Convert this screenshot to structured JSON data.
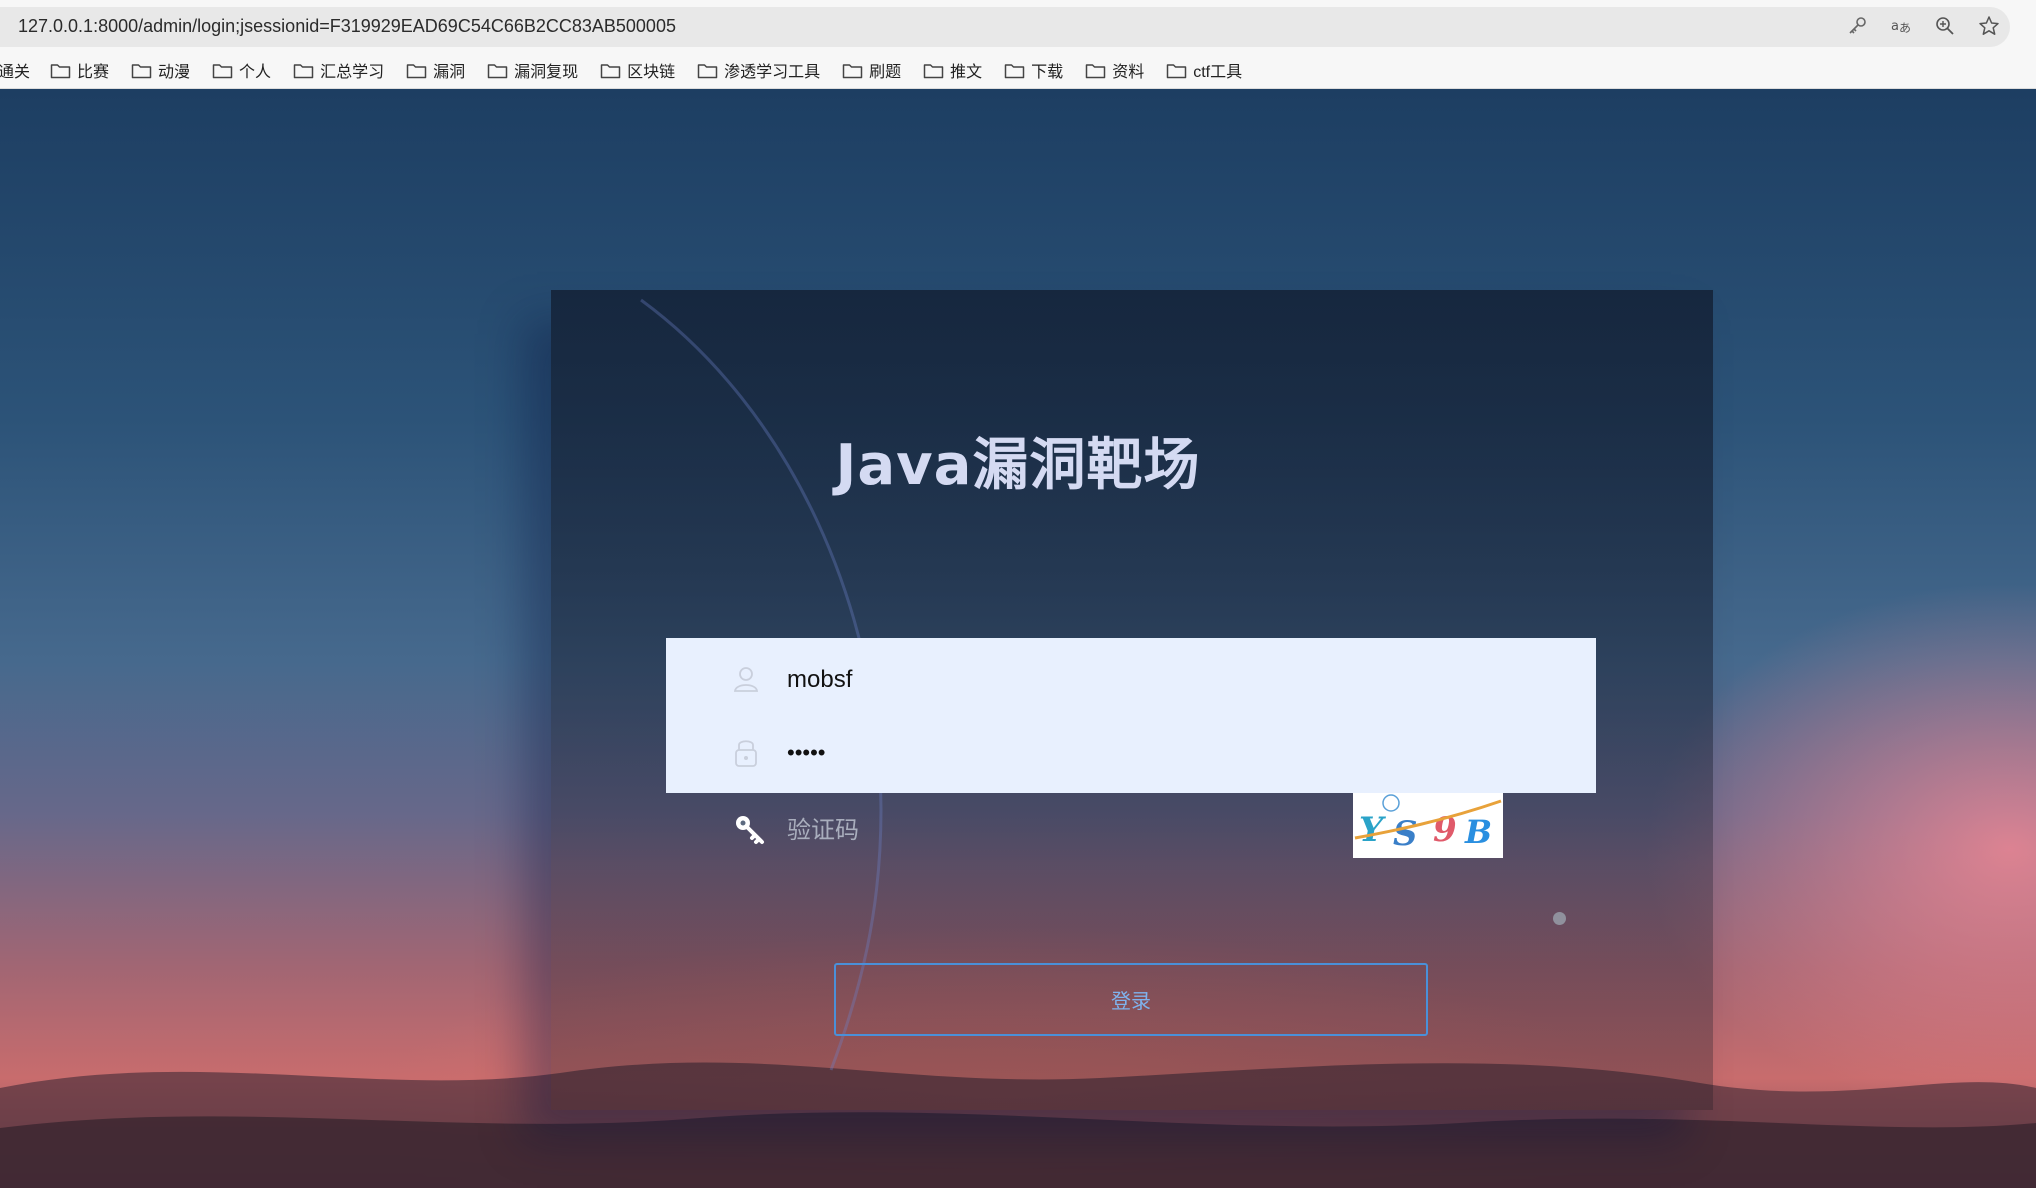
{
  "browser": {
    "url": "127.0.0.1:8000/admin/login;jsessionid=F319929EAD69C54C66B2CC83AB500005",
    "address_icons": [
      "key-icon",
      "translate-icon",
      "zoom-icon",
      "star-icon"
    ],
    "bookmarks_first": "通关",
    "bookmarks": [
      {
        "label": "比赛"
      },
      {
        "label": "动漫"
      },
      {
        "label": "个人"
      },
      {
        "label": "汇总学习"
      },
      {
        "label": "漏洞"
      },
      {
        "label": "漏洞复现"
      },
      {
        "label": "区块链"
      },
      {
        "label": "渗透学习工具"
      },
      {
        "label": "刷题"
      },
      {
        "label": "推文"
      },
      {
        "label": "下载"
      },
      {
        "label": "资料"
      },
      {
        "label": "ctf工具"
      }
    ]
  },
  "login": {
    "title": "Java漏洞靶场",
    "username_value": "mobsf",
    "password_value": "•••••",
    "captcha_placeholder": "验证码",
    "captcha_text": "YS9B",
    "submit_label": "登录"
  },
  "colors": {
    "button_border": "#4a90d9",
    "autofill_bg": "#e8f0fe",
    "title_color": "#d4daf2"
  }
}
